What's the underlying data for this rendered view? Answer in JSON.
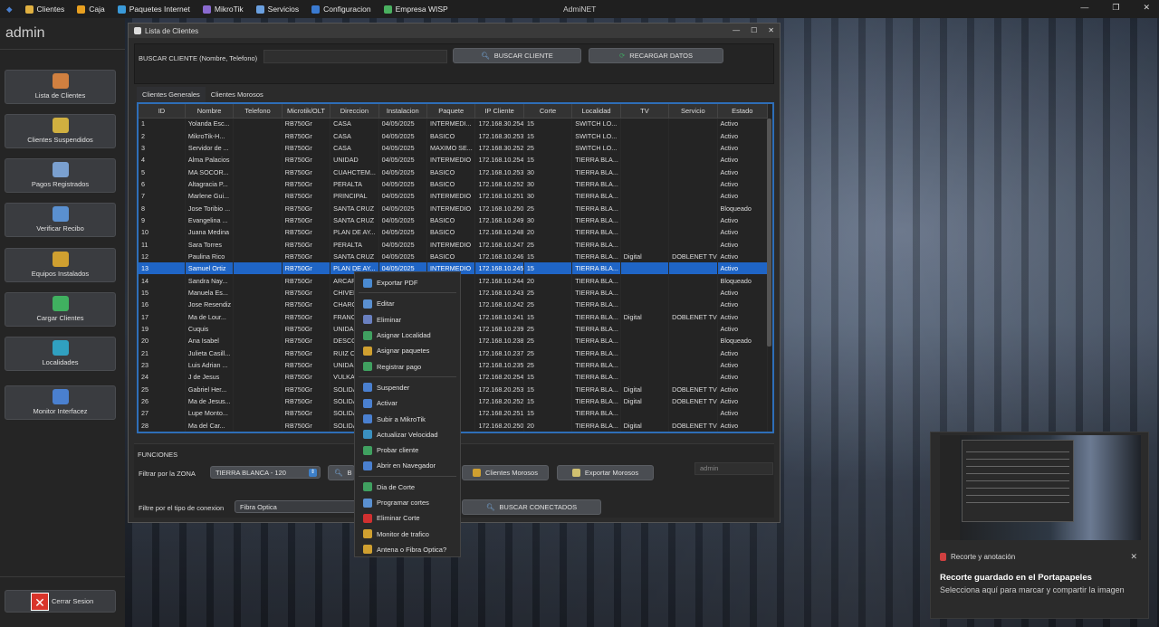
{
  "menubar": {
    "items": [
      {
        "label": "Clientes",
        "icon": "folder-icon",
        "color": "#e0b040"
      },
      {
        "label": "Caja",
        "icon": "coins-icon",
        "color": "#e8a020"
      },
      {
        "label": "Paquetes Internet",
        "icon": "globe-icon",
        "color": "#3a9ad9"
      },
      {
        "label": "MikroTik",
        "icon": "router-icon",
        "color": "#8a6ad0"
      },
      {
        "label": "Servicios",
        "icon": "services-icon",
        "color": "#6aa0e0"
      },
      {
        "label": "Configuracion",
        "icon": "config-icon",
        "color": "#3a7ad0"
      },
      {
        "label": "Empresa WISP",
        "icon": "building-icon",
        "color": "#4ab060"
      }
    ],
    "app_title": "AdmiNET",
    "min": "—",
    "max": "❐",
    "close": "✕"
  },
  "sidebar": {
    "user": "admin",
    "buttons": [
      {
        "label": "Lista de Clientes",
        "color": "#d08040"
      },
      {
        "label": "Clientes Suspendidos",
        "color": "#d0b040"
      },
      {
        "label": "Pagos Registrados",
        "color": "#7aa0d0"
      },
      {
        "label": "Verificar Recibo",
        "color": "#5a90d0"
      },
      {
        "label": "Equipos Instalados",
        "color": "#d0a030"
      },
      {
        "label": "Cargar Clientes",
        "color": "#40b060"
      },
      {
        "label": "Localidades",
        "color": "#30a0c0"
      },
      {
        "label": "Monitor Interfacez",
        "color": "#4a80d0"
      }
    ],
    "logout": "Cerrar Sesion"
  },
  "window": {
    "title": "Lista de Clientes",
    "search_label": "BUSCAR CLIENTE (Nombre, Telefono)",
    "search_value": "",
    "search_button": "BUSCAR CLIENTE",
    "reload_button": "RECARGAR DATOS",
    "tabs": [
      "Clientes Generales",
      "Clientes Morosos"
    ],
    "columns": [
      "ID",
      "Nombre",
      "Telefono",
      "Microtik/OLT",
      "Direccion",
      "Instalacion",
      "Paquete",
      "IP Cliente",
      "Corte",
      "Localidad",
      "TV",
      "Servicio",
      "Estado"
    ],
    "rows": [
      [
        "1",
        "Yolanda Esc...",
        "",
        "RB750Gr",
        "CASA",
        "04/05/2025",
        "INTERMEDI...",
        "172.168.30.254",
        "15",
        "SWITCH LO...",
        "",
        "",
        "Activo"
      ],
      [
        "2",
        "MikroTik-H...",
        "",
        "RB750Gr",
        "CASA",
        "04/05/2025",
        "BASICO",
        "172.168.30.253",
        "15",
        "SWITCH LO...",
        "",
        "",
        "Activo"
      ],
      [
        "3",
        "Servidor de ...",
        "",
        "RB750Gr",
        "CASA",
        "04/05/2025",
        "MAXIMO SE...",
        "172.168.30.252",
        "25",
        "SWITCH LO...",
        "",
        "",
        "Activo"
      ],
      [
        "4",
        "Alma Palacios",
        "",
        "RB750Gr",
        "UNIDAD",
        "04/05/2025",
        "INTERMEDIO",
        "172.168.10.254",
        "15",
        "TIERRA BLA...",
        "",
        "",
        "Activo"
      ],
      [
        "5",
        "MA SOCOR...",
        "",
        "RB750Gr",
        "CUAHCTEM...",
        "04/05/2025",
        "BASICO",
        "172.168.10.253",
        "30",
        "TIERRA BLA...",
        "",
        "",
        "Activo"
      ],
      [
        "6",
        "Altagracia P...",
        "",
        "RB750Gr",
        "PERALTA",
        "04/05/2025",
        "BASICO",
        "172.168.10.252",
        "30",
        "TIERRA BLA...",
        "",
        "",
        "Activo"
      ],
      [
        "7",
        "Marlene Gui...",
        "",
        "RB750Gr",
        "PRINCIPAL",
        "04/05/2025",
        "INTERMEDIO",
        "172.168.10.251",
        "30",
        "TIERRA BLA...",
        "",
        "",
        "Activo"
      ],
      [
        "8",
        "Jose Toribio ...",
        "",
        "RB750Gr",
        "SANTA CRUZ",
        "04/05/2025",
        "INTERMEDIO",
        "172.168.10.250",
        "25",
        "TIERRA BLA...",
        "",
        "",
        "Bloqueado"
      ],
      [
        "9",
        "Evangelina ...",
        "",
        "RB750Gr",
        "SANTA CRUZ",
        "04/05/2025",
        "BASICO",
        "172.168.10.249",
        "30",
        "TIERRA BLA...",
        "",
        "",
        "Activo"
      ],
      [
        "10",
        "Juana Medina",
        "",
        "RB750Gr",
        "PLAN DE AY...",
        "04/05/2025",
        "BASICO",
        "172.168.10.248",
        "20",
        "TIERRA BLA...",
        "",
        "",
        "Activo"
      ],
      [
        "11",
        "Sara Torres",
        "",
        "RB750Gr",
        "PERALTA",
        "04/05/2025",
        "INTERMEDIO",
        "172.168.10.247",
        "25",
        "TIERRA BLA...",
        "",
        "",
        "Activo"
      ],
      [
        "12",
        "Paulina Rico",
        "",
        "RB750Gr",
        "SANTA CRUZ",
        "04/05/2025",
        "BASICO",
        "172.168.10.246",
        "15",
        "TIERRA BLA...",
        "Digital",
        "DOBLENET TV",
        "Activo"
      ],
      [
        "13",
        "Samuel Ortiz",
        "",
        "RB750Gr",
        "PLAN DE AY...",
        "04/05/2025",
        "INTERMEDIO",
        "172.168.10.245",
        "15",
        "TIERRA BLA...",
        "",
        "",
        "Activo"
      ],
      [
        "14",
        "Sandra Nay...",
        "",
        "RB750Gr",
        "ARCAR",
        "",
        "IO",
        "172.168.10.244",
        "20",
        "TIERRA BLA...",
        "",
        "",
        "Bloqueado"
      ],
      [
        "15",
        "Manuela Es...",
        "",
        "RB750Gr",
        "CHIVER",
        "",
        "IO",
        "172.168.10.243",
        "25",
        "TIERRA BLA...",
        "",
        "",
        "Activo"
      ],
      [
        "16",
        "Jose Resendiz",
        "",
        "RB750Gr",
        "CHARC",
        "",
        "IO",
        "172.168.10.242",
        "25",
        "TIERRA BLA...",
        "",
        "",
        "Activo"
      ],
      [
        "17",
        "Ma de Lour...",
        "",
        "RB750Gr",
        "FRANC",
        "",
        "IO",
        "172.168.10.241",
        "15",
        "TIERRA BLA...",
        "Digital",
        "DOBLENET TV",
        "Activo"
      ],
      [
        "19",
        "Cuquis",
        "",
        "RB750Gr",
        "UNIDA",
        "",
        "",
        "172.168.10.239",
        "25",
        "TIERRA BLA...",
        "",
        "",
        "Activo"
      ],
      [
        "20",
        "Ana Isabel",
        "",
        "RB750Gr",
        "DESCO",
        "",
        "IO",
        "172.168.10.238",
        "25",
        "TIERRA BLA...",
        "",
        "",
        "Bloqueado"
      ],
      [
        "21",
        "Julieta Casill...",
        "",
        "RB750Gr",
        "RUIZ C",
        "",
        "IO",
        "172.168.10.237",
        "25",
        "TIERRA BLA...",
        "",
        "",
        "Activo"
      ],
      [
        "23",
        "Luis Adrian ...",
        "",
        "RB750Gr",
        "UNIDA",
        "",
        "IO",
        "172.168.10.235",
        "25",
        "TIERRA BLA...",
        "",
        "",
        "Activo"
      ],
      [
        "24",
        "J de Jesus",
        "",
        "RB750Gr",
        "VULKA",
        "",
        "",
        "172.168.20.254",
        "15",
        "TIERRA BLA...",
        "",
        "",
        "Activo"
      ],
      [
        "25",
        "Gabriel Her...",
        "",
        "RB750Gr",
        "SOLIDA",
        "",
        "IO",
        "172.168.20.253",
        "15",
        "TIERRA BLA...",
        "Digital",
        "DOBLENET TV",
        "Activo"
      ],
      [
        "26",
        "Ma de Jesus...",
        "",
        "RB750Gr",
        "SOLIDA",
        "",
        "IO",
        "172.168.20.252",
        "15",
        "TIERRA BLA...",
        "Digital",
        "DOBLENET TV",
        "Activo"
      ],
      [
        "27",
        "Lupe Monto...",
        "",
        "RB750Gr",
        "SOLIDA",
        "",
        "IO",
        "172.168.20.251",
        "15",
        "TIERRA BLA...",
        "",
        "",
        "Activo"
      ],
      [
        "28",
        "Ma del Car...",
        "",
        "RB750Gr",
        "SOLIDA",
        "",
        "IO",
        "172.168.20.250",
        "20",
        "TIERRA BLA...",
        "Digital",
        "DOBLENET TV",
        "Activo"
      ]
    ],
    "selected_row": 12,
    "funciones": {
      "title": "FUNCIONES",
      "zone_label": "Filtrar por la ZONA",
      "zone_value": "TIERRA BLANCA - 120",
      "zone_btn_partial": "B",
      "morosos_btn": "Clientes Morosos",
      "export_morosos_btn": "Exportar Morosos",
      "user_field": "admin",
      "conn_label": "Filtre por el tipo de conexion",
      "conn_value": "Fibra Optica",
      "conn_btn": "BUSCAR CONECTADOS"
    }
  },
  "context_menu": {
    "groups": [
      [
        {
          "label": "Exportar PDF",
          "icon": "pdf-icon",
          "color": "#4a8ad0"
        }
      ],
      [
        {
          "label": "Editar",
          "icon": "edit-icon",
          "color": "#5a90d0"
        },
        {
          "label": "Eliminar",
          "icon": "delete-icon",
          "color": "#6a80c0"
        },
        {
          "label": "Asignar Localidad",
          "icon": "location-icon",
          "color": "#40a060"
        },
        {
          "label": "Asignar paquetes",
          "icon": "package-icon",
          "color": "#d0a030"
        },
        {
          "label": "Registrar pago",
          "icon": "payment-icon",
          "color": "#40a060"
        }
      ],
      [
        {
          "label": "Suspender",
          "icon": "suspend-icon",
          "color": "#4a80d0"
        },
        {
          "label": "Activar",
          "icon": "activate-icon",
          "color": "#4a80d0"
        },
        {
          "label": "Subir a MikroTik",
          "icon": "upload-icon",
          "color": "#4a80d0"
        },
        {
          "label": "Actualizar Velocidad",
          "icon": "speed-icon",
          "color": "#3a90c0"
        },
        {
          "label": "Probar cliente",
          "icon": "test-icon",
          "color": "#40a060"
        },
        {
          "label": "Abrir en Navegador",
          "icon": "browser-icon",
          "color": "#4a80d0"
        }
      ],
      [
        {
          "label": "Dia de Corte",
          "icon": "calendar-icon",
          "color": "#40a060"
        },
        {
          "label": "Programar cortes",
          "icon": "schedule-icon",
          "color": "#5a90d0"
        },
        {
          "label": "Eliminar Corte",
          "icon": "remove-cut-icon",
          "color": "#d03030"
        },
        {
          "label": "Monitor de trafico",
          "icon": "traffic-icon",
          "color": "#d0a030"
        },
        {
          "label": "Antena o Fibra Optica?",
          "icon": "antenna-icon",
          "color": "#d0a030"
        }
      ]
    ]
  },
  "notification": {
    "app": "Recorte y anotación",
    "title": "Recorte guardado en el Portapapeles",
    "body": "Selecciona aquí para marcar y compartir la imagen",
    "close": "✕"
  }
}
